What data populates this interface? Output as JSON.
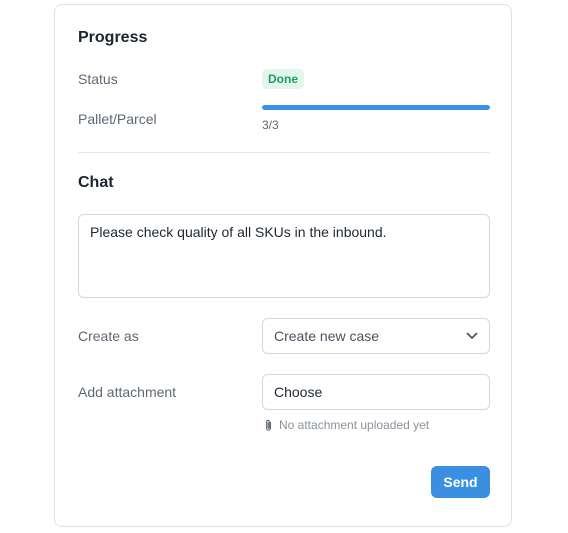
{
  "progress": {
    "title": "Progress",
    "status_label": "Status",
    "status_value": "Done",
    "pallet_label": "Pallet/Parcel",
    "pallet_text": "3/3",
    "pallet_fraction": 1.0
  },
  "chat": {
    "title": "Chat",
    "message": "Please check quality of all SKUs in the inbound.",
    "create_as_label": "Create as",
    "create_as_value": "Create new case",
    "attachment_label": "Add attachment",
    "attachment_button": "Choose",
    "attachment_note": "No attachment uploaded yet",
    "send_label": "Send"
  },
  "colors": {
    "accent": "#3a8fe0",
    "success": "#1f9d63",
    "success_bg": "#e3f6ec"
  },
  "icons": {
    "dropdown": "chevron-down-icon",
    "attachment": "paperclip-icon"
  }
}
